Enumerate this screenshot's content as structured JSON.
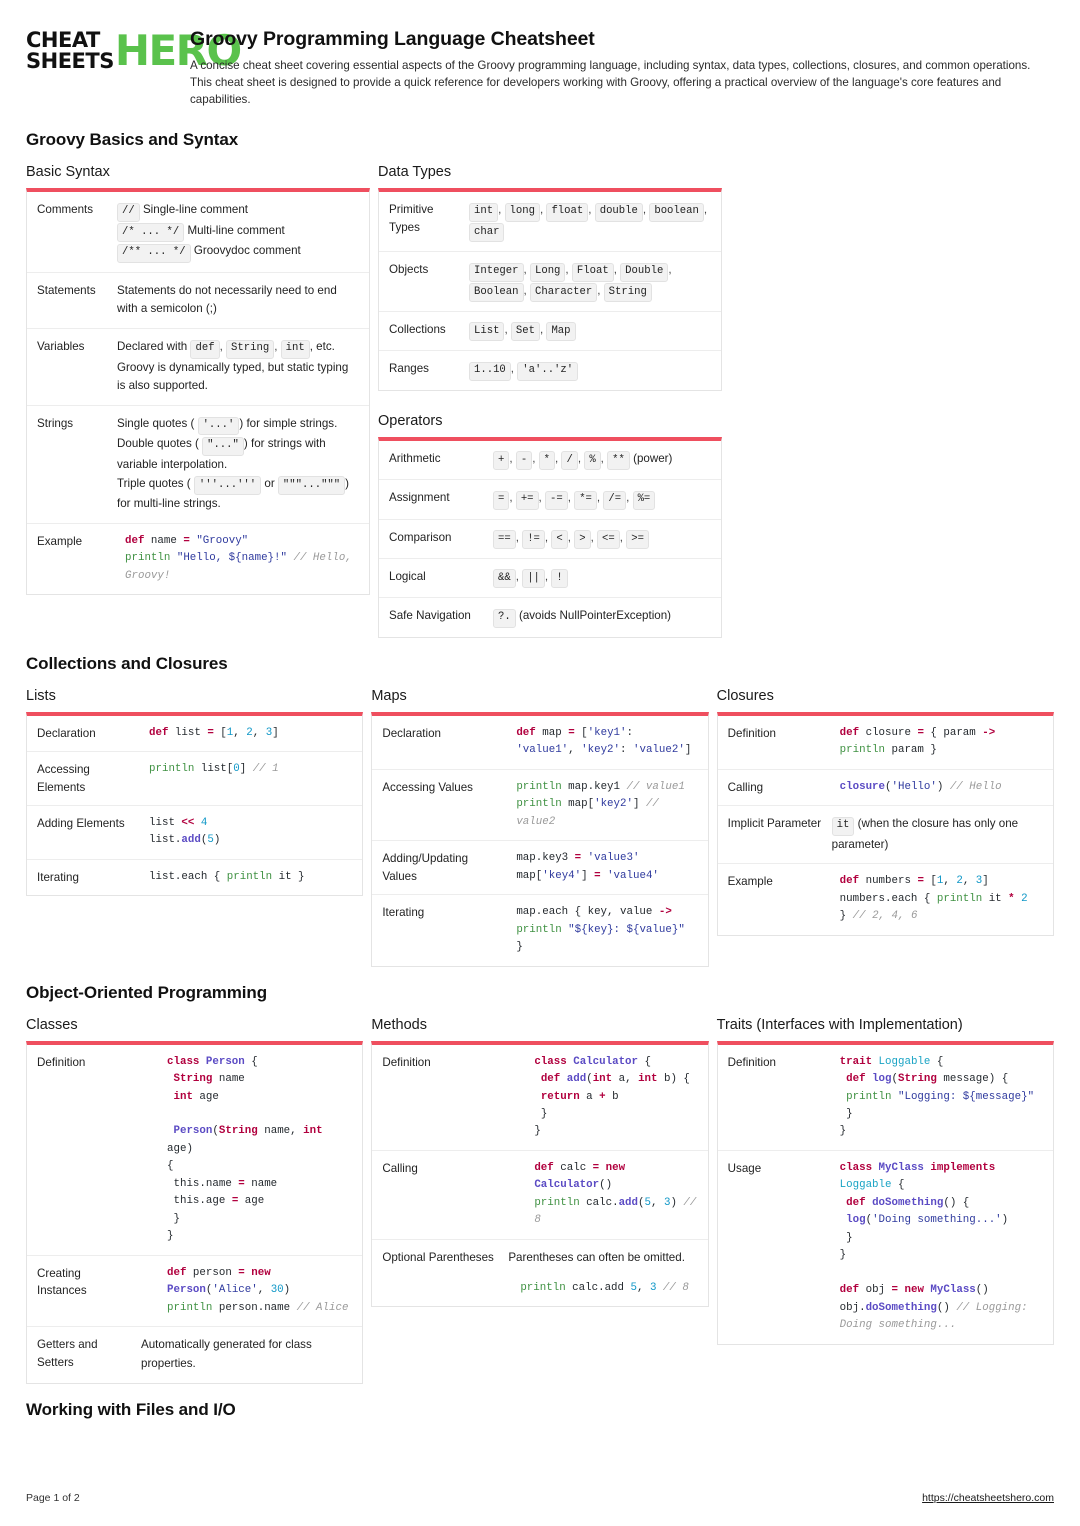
{
  "brand": {
    "line1": "CHEAT",
    "line2": "SHEETS",
    "hero": "HERO",
    "hero_color": "#5ac24c"
  },
  "header": {
    "title": "Groovy Programming Language Cheatsheet",
    "description": "A concise cheat sheet covering essential aspects of the Groovy programming language, including syntax, data types, collections, closures, and common operations. This cheat sheet is designed to provide a quick reference for developers working with Groovy, offering a practical overview of the language's core features and capabilities."
  },
  "accent_color": "#ef4f5f",
  "sections": {
    "basics": "Groovy Basics and Syntax",
    "collections": "Collections and Closures",
    "oop": "Object-Oriented Programming",
    "files": "Working with Files and I/O"
  },
  "cards": {
    "basic_syntax": {
      "title": "Basic Syntax",
      "rows": {
        "comments": {
          "label": "Comments",
          "chip1": "//",
          "text1": "Single-line comment",
          "chip2": "/* ... */",
          "text2": "Multi-line comment",
          "chip3": "/** ... */",
          "text3": "Groovydoc comment"
        },
        "statements": {
          "label": "Statements",
          "text": "Statements do not necessarily need to end with a semicolon (;)"
        },
        "variables": {
          "label": "Variables",
          "pre": "Declared with",
          "c1": "def",
          "c2": "String",
          "c3": "int",
          "post": ", etc. Groovy is dynamically typed, but static typing is also supported."
        },
        "strings": {
          "label": "Strings",
          "l1a": "Single quotes (",
          "l1c": "'...'",
          "l1b": ") for simple strings.",
          "l2a": "Double quotes (",
          "l2c": "\"...\"",
          "l2b": ") for strings with variable interpolation.",
          "l3a": "Triple quotes (",
          "l3c": "'''...'''",
          "l3mid": "or",
          "l3c2": "\"\"\"...\"\"\"",
          "l3b": ") for multi-line strings."
        },
        "example": {
          "label": "Example",
          "code": "def name = \"Groovy\"\nprintln \"Hello, ${name}!\" // Hello, Groovy!"
        }
      }
    },
    "data_types": {
      "title": "Data Types",
      "rows": {
        "primitive": {
          "label": "Primitive Types",
          "items": [
            "int",
            "long",
            "float",
            "double",
            "boolean",
            "char"
          ]
        },
        "objects": {
          "label": "Objects",
          "items": [
            "Integer",
            "Long",
            "Float",
            "Double",
            "Boolean",
            "Character",
            "String"
          ]
        },
        "collections": {
          "label": "Collections",
          "items": [
            "List",
            "Set",
            "Map"
          ]
        },
        "ranges": {
          "label": "Ranges",
          "items": [
            "1..10",
            "'a'..'z'"
          ]
        }
      }
    },
    "operators": {
      "title": "Operators",
      "rows": {
        "arithmetic": {
          "label": "Arithmetic",
          "items": [
            "+",
            "-",
            "*",
            "/",
            "%",
            "**"
          ],
          "note": "(power)"
        },
        "assignment": {
          "label": "Assignment",
          "items": [
            "=",
            "+=",
            "-=",
            "*=",
            "/=",
            "%="
          ],
          "note": ""
        },
        "comparison": {
          "label": "Comparison",
          "items": [
            "==",
            "!=",
            "<",
            ">",
            "<=",
            ">="
          ],
          "note": ""
        },
        "logical": {
          "label": "Logical",
          "items": [
            "&&",
            "||",
            "!"
          ],
          "note": ""
        },
        "safe_nav": {
          "label": "Safe Navigation",
          "items": [
            "?."
          ],
          "note": "(avoids NullPointerException)"
        }
      }
    },
    "lists": {
      "title": "Lists",
      "rows": [
        {
          "label": "Declaration",
          "code": "def list = [1, 2, 3]"
        },
        {
          "label": "Accessing Elements",
          "code": "println list[0] // 1"
        },
        {
          "label": "Adding Elements",
          "code": "list << 4\nlist.add(5)"
        },
        {
          "label": "Iterating",
          "code": "list.each { println it }"
        }
      ]
    },
    "maps": {
      "title": "Maps",
      "rows": [
        {
          "label": "Declaration",
          "code": "def map = ['key1': 'value1', 'key2': 'value2']"
        },
        {
          "label": "Accessing Values",
          "code": "println map.key1 // value1\nprintln map['key2'] // value2"
        },
        {
          "label": "Adding/Updating Values",
          "code": "map.key3 = 'value3'\nmap['key4'] = 'value4'"
        },
        {
          "label": "Iterating",
          "code": "map.each { key, value ->\nprintln \"${key}: ${value}\"\n}"
        }
      ]
    },
    "closures": {
      "title": "Closures",
      "rows": {
        "definition": {
          "label": "Definition",
          "code": "def closure = { param ->\nprintln param }"
        },
        "calling": {
          "label": "Calling",
          "code": "closure('Hello') // Hello"
        },
        "implicit": {
          "label": "Implicit Parameter",
          "chip": "it",
          "text": "(when the closure has only one parameter)"
        },
        "example": {
          "label": "Example",
          "code": "def numbers = [1, 2, 3]\nnumbers.each { println it * 2\n} // 2, 4, 6"
        }
      }
    },
    "classes": {
      "title": "Classes",
      "rows": {
        "definition": {
          "label": "Definition",
          "code": "class Person {\n String name\n int age\n\n Person(String name, int age)\n{\n this.name = name\n this.age = age\n }\n}"
        },
        "creating": {
          "label": "Creating Instances",
          "code": "def person = new\nPerson('Alice', 30)\nprintln person.name // Alice"
        },
        "getters": {
          "label": "Getters and Setters",
          "text": "Automatically generated for class properties."
        }
      }
    },
    "methods": {
      "title": "Methods",
      "rows": {
        "definition": {
          "label": "Definition",
          "code": "class Calculator {\n def add(int a, int b) {\n return a + b\n }\n}"
        },
        "calling": {
          "label": "Calling",
          "code": "def calc = new\nCalculator()\nprintln calc.add(5, 3) // 8"
        },
        "optional": {
          "label": "Optional Parentheses",
          "text": "Parentheses can often be omitted.",
          "code": "println calc.add 5, 3 // 8"
        }
      }
    },
    "traits": {
      "title": "Traits (Interfaces with Implementation)",
      "rows": {
        "definition": {
          "label": "Definition",
          "code": "trait Loggable {\n def log(String message) {\n println \"Logging: ${message}\"\n }\n}"
        },
        "usage": {
          "label": "Usage",
          "code": "class MyClass implements Loggable {\n def doSomething() {\n log('Doing something...')\n }\n}\n\ndef obj = new MyClass()\nobj.doSomething() // Logging: Doing something..."
        }
      }
    }
  },
  "footer": {
    "page": "Page 1 of 2",
    "url": "https://cheatsheetshero.com"
  }
}
